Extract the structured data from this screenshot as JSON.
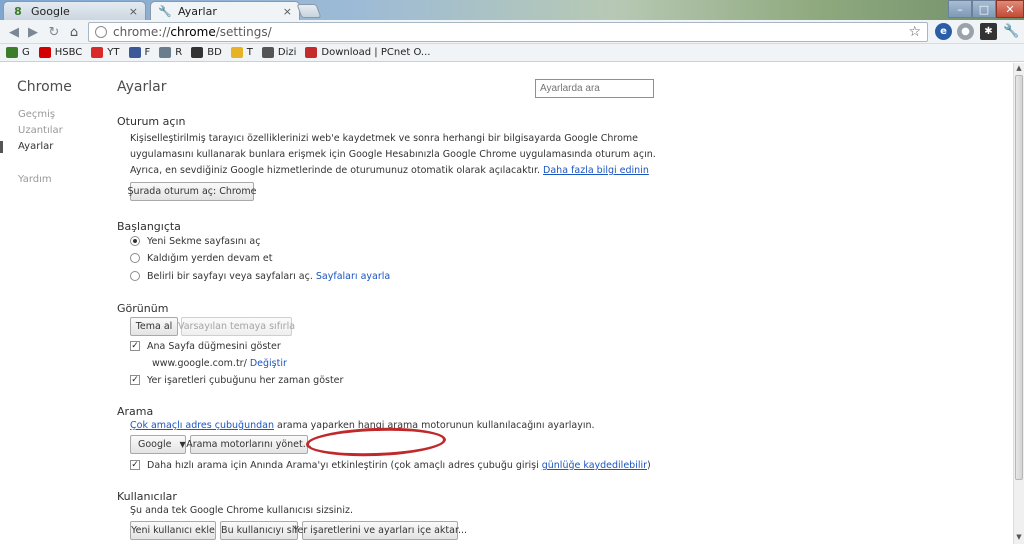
{
  "tabs": [
    {
      "title": "Google",
      "close": "×"
    },
    {
      "title": "Ayarlar",
      "close": "×"
    }
  ],
  "window_controls": {
    "minimize": "–",
    "maximize": "□",
    "close": "✕"
  },
  "toolbar": {
    "url_prefix": "chrome://",
    "url_host": "chrome",
    "url_path": "/settings/"
  },
  "bookmarks": [
    {
      "label": "G",
      "icon": "google-icon",
      "color": "#3b7d2a"
    },
    {
      "label": "HSBC",
      "icon": "hsbc-icon",
      "color": "#d40000"
    },
    {
      "label": "YT",
      "icon": "youtube-icon",
      "color": "#d92a2a"
    },
    {
      "label": "F",
      "icon": "facebook-icon",
      "color": "#3b5998"
    },
    {
      "label": "R",
      "icon": "bookmark-icon",
      "color": "#6b7c8c"
    },
    {
      "label": "BD",
      "icon": "bookmark-icon",
      "color": "#333333"
    },
    {
      "label": "T",
      "icon": "bookmark-icon",
      "color": "#e5b325"
    },
    {
      "label": "Dizi",
      "icon": "bookmark-icon",
      "color": "#555555"
    },
    {
      "label": "Download | PCnet O...",
      "icon": "pcnet-icon",
      "color": "#c62b2b"
    }
  ],
  "sidebar": {
    "brand": "Chrome",
    "items": [
      {
        "label": "Geçmiş"
      },
      {
        "label": "Uzantılar"
      },
      {
        "label": "Ayarlar"
      },
      {
        "label": "Yardım"
      }
    ]
  },
  "settings": {
    "title": "Ayarlar",
    "search_placeholder": "Ayarlarda ara",
    "signin": {
      "heading": "Oturum açın",
      "line1": "Kişiselleştirilmiş tarayıcı özelliklerinizi web'e kaydetmek ve sonra herhangi bir bilgisayarda Google Chrome",
      "line2": "uygulamasını kullanarak bunlara erişmek için Google Hesabınızla Google Chrome uygulamasında oturum açın.",
      "line3": "Ayrıca, en sevdiğiniz Google hizmetlerinde de oturumunuz otomatik olarak açılacaktır.",
      "learn_more": "Daha fazla bilgi edinin",
      "button": "Şurada oturum aç: Chrome"
    },
    "startup": {
      "heading": "Başlangıçta",
      "opt1": "Yeni Sekme sayfasını aç",
      "opt2": "Kaldığım yerden devam et",
      "opt3": "Belirli bir sayfayı veya sayfaları aç.",
      "set_pages": "Sayfaları ayarla"
    },
    "appearance": {
      "heading": "Görünüm",
      "get_themes": "Tema al",
      "reset_theme": "Varsayılan temaya sıfırla",
      "show_home": "Ana Sayfa düğmesini göster",
      "home_url": "www.google.com.tr/",
      "change": "Değiştir",
      "show_bookmarks": "Yer işaretleri çubuğunu her zaman göster"
    },
    "search": {
      "heading": "Arama",
      "omnibox_link": "Çok amaçlı adres çubuğundan",
      "desc_rest": " arama yaparken hangi arama motorunun kullanılacağını ayarlayın.",
      "engine": "Google",
      "manage": "Arama motorlarını yönet...",
      "instant_text": "Daha hızlı arama için Anında Arama'yı etkinleştirin (çok amaçlı adres çubuğu girişi ",
      "instant_link": "günlüğe kaydedilebilir",
      "instant_close": ")"
    },
    "users": {
      "heading": "Kullanıcılar",
      "desc": "Şu anda tek Google Chrome kullanıcısı sizsiniz.",
      "add": "Yeni kullanıcı ekle",
      "delete": "Bu kullanıcıyı sil",
      "import": "Yer işaretlerini ve ayarları içe aktar..."
    }
  },
  "colors": {
    "accent_link": "#1a55c2",
    "annotation_circle": "#c0282a"
  }
}
